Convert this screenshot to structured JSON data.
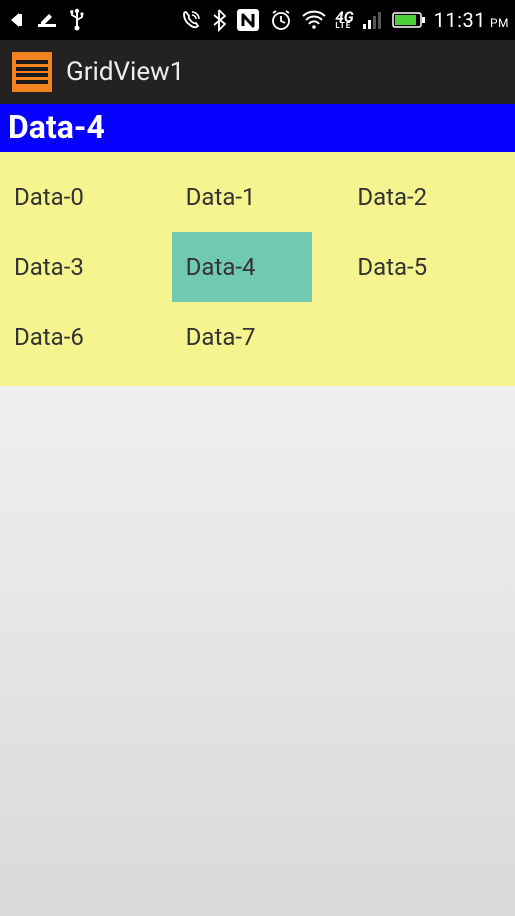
{
  "status": {
    "time": "11:31",
    "ampm": "PM"
  },
  "actionBar": {
    "title": "GridView1"
  },
  "selectedHeader": "Data-4",
  "grid": {
    "selectedIndex": 4,
    "items": [
      "Data-0",
      "Data-1",
      "Data-2",
      "Data-3",
      "Data-4",
      "Data-5",
      "Data-6",
      "Data-7"
    ]
  }
}
